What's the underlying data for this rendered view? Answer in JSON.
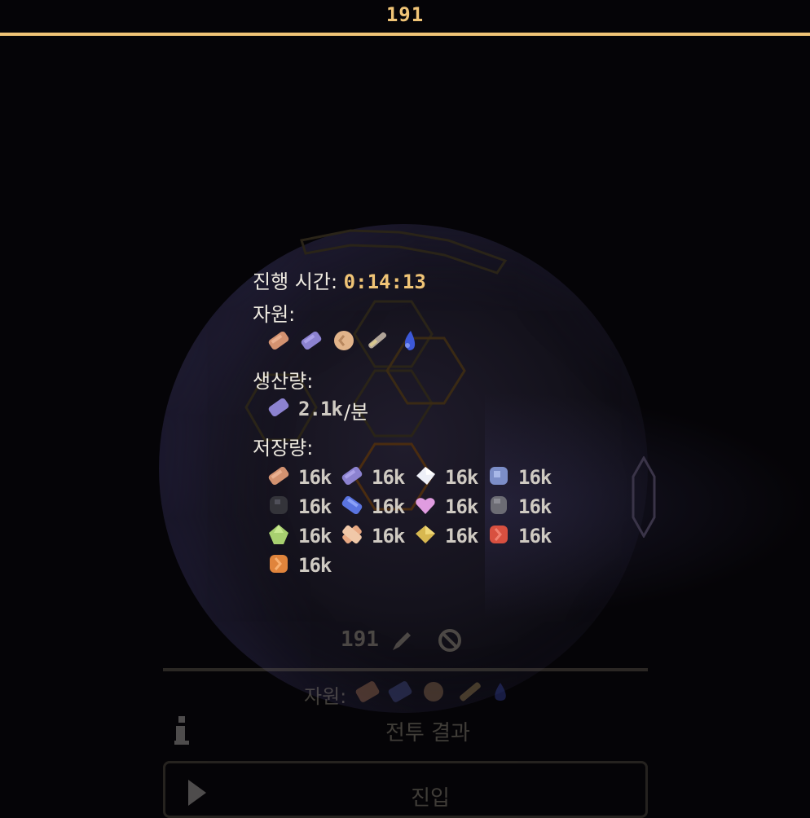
{
  "header": {
    "title": "191"
  },
  "tooltip": {
    "time_label": "진행 시간: ",
    "time_value": "0:14:13",
    "resources_label": "자원:",
    "resources": [
      "copper-ingot-icon",
      "amethyst-ingot-icon",
      "sand-orb-icon",
      "wrench-tool-icon",
      "blue-drop-icon"
    ],
    "production_label": "생산량:",
    "production": {
      "icon": "amethyst-ingot-icon",
      "value": "2.1k",
      "unit": " /분"
    },
    "storage_label": "저장량:",
    "storage": [
      {
        "icon": "copper-ingot-icon",
        "value": "16k"
      },
      {
        "icon": "amethyst-ingot-icon",
        "value": "16k"
      },
      {
        "icon": "white-crystal-icon",
        "value": "16k"
      },
      {
        "icon": "blue-ore-icon",
        "value": "16k"
      },
      {
        "icon": "coal-icon",
        "value": "16k"
      },
      {
        "icon": "blue-ingot-icon",
        "value": "16k"
      },
      {
        "icon": "pink-heart-icon",
        "value": "16k"
      },
      {
        "icon": "gray-stone-icon",
        "value": "16k"
      },
      {
        "icon": "green-gem-icon",
        "value": "16k"
      },
      {
        "icon": "striped-ingot-icon",
        "value": "16k"
      },
      {
        "icon": "yellow-ingot-icon",
        "value": "16k"
      },
      {
        "icon": "red-ore-icon",
        "value": "16k"
      },
      {
        "icon": "orange-ore-icon",
        "value": "16k"
      }
    ]
  },
  "panel": {
    "name": "191",
    "resources_label": "자원:",
    "info_label": "전투 결과",
    "enter_label": "진입"
  },
  "colors": {
    "accent": "#f0c476",
    "background": "#050407"
  }
}
